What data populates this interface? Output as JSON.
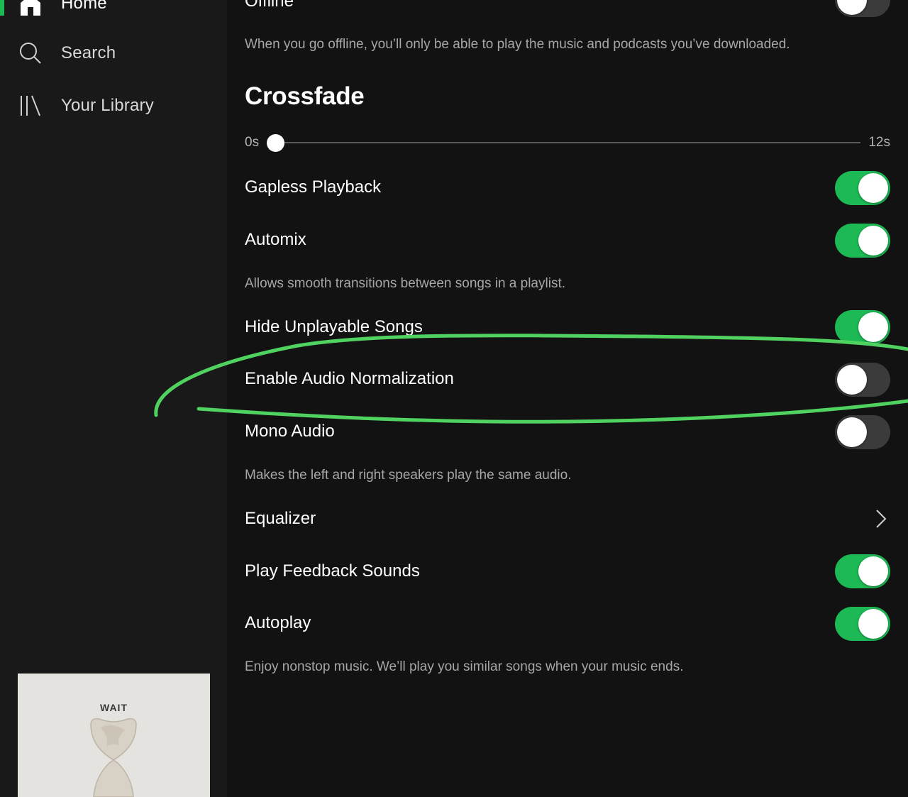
{
  "sidebar": {
    "items": [
      {
        "label": "Home",
        "icon": "home-icon"
      },
      {
        "label": "Search",
        "icon": "search-icon"
      },
      {
        "label": "Your Library",
        "icon": "library-icon"
      }
    ],
    "album": {
      "title": "WAIT"
    }
  },
  "settings": {
    "offline": {
      "label": "Offline",
      "description": "When you go offline, you’ll only be able to play the music and podcasts you’ve downloaded.",
      "enabled": false
    },
    "crossfade": {
      "heading": "Crossfade",
      "min_label": "0s",
      "max_label": "12s",
      "value_seconds": 0
    },
    "gapless": {
      "label": "Gapless Playback",
      "enabled": true
    },
    "automix": {
      "label": "Automix",
      "description": "Allows smooth transitions between songs in a playlist.",
      "enabled": true
    },
    "hide_unplayable": {
      "label": "Hide Unplayable Songs",
      "enabled": true
    },
    "normalization": {
      "label": "Enable Audio Normalization",
      "enabled": false
    },
    "mono": {
      "label": "Mono Audio",
      "description": "Makes the left and right speakers play the same audio.",
      "enabled": false
    },
    "equalizer": {
      "label": "Equalizer"
    },
    "feedback_sounds": {
      "label": "Play Feedback Sounds",
      "enabled": true
    },
    "autoplay": {
      "label": "Autoplay",
      "description": "Enjoy nonstop music. We’ll play you similar songs when your music ends.",
      "enabled": true
    }
  },
  "colors": {
    "accent": "#1db954",
    "background": "#121212",
    "sidebar": "#191919",
    "annotation": "#4fd25f"
  }
}
